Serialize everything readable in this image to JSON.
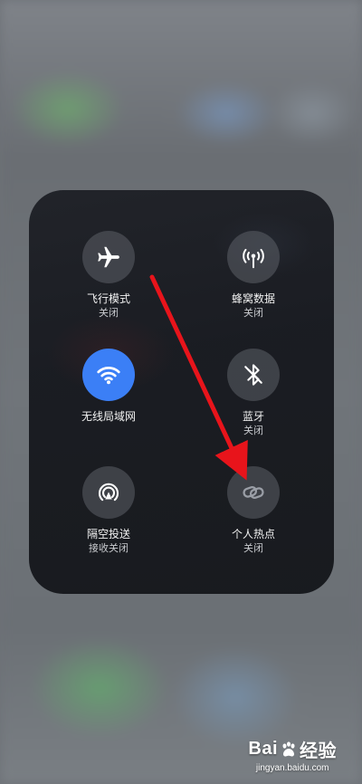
{
  "control_center": {
    "tiles": [
      {
        "icon": "airplane-icon",
        "label": "飞行模式",
        "status": "关闭",
        "active": false
      },
      {
        "icon": "cellular-data-icon",
        "label": "蜂窝数据",
        "status": "关闭",
        "active": false
      },
      {
        "icon": "wifi-icon",
        "label": "无线局域网",
        "status": "",
        "active": true
      },
      {
        "icon": "bluetooth-icon",
        "label": "蓝牙",
        "status": "关闭",
        "active": false
      },
      {
        "icon": "airdrop-icon",
        "label": "隔空投送",
        "status": "接收关闭",
        "active": false
      },
      {
        "icon": "personal-hotspot-icon",
        "label": "个人热点",
        "status": "关闭",
        "active": false
      }
    ]
  },
  "colors": {
    "active_tile": "#3b7ff6",
    "inactive_tile": "#5c6068",
    "annotation_arrow": "#e8141b"
  },
  "watermark": {
    "brand_left": "Bai",
    "brand_right": "经验",
    "site": "jingyan.baidu.com"
  }
}
